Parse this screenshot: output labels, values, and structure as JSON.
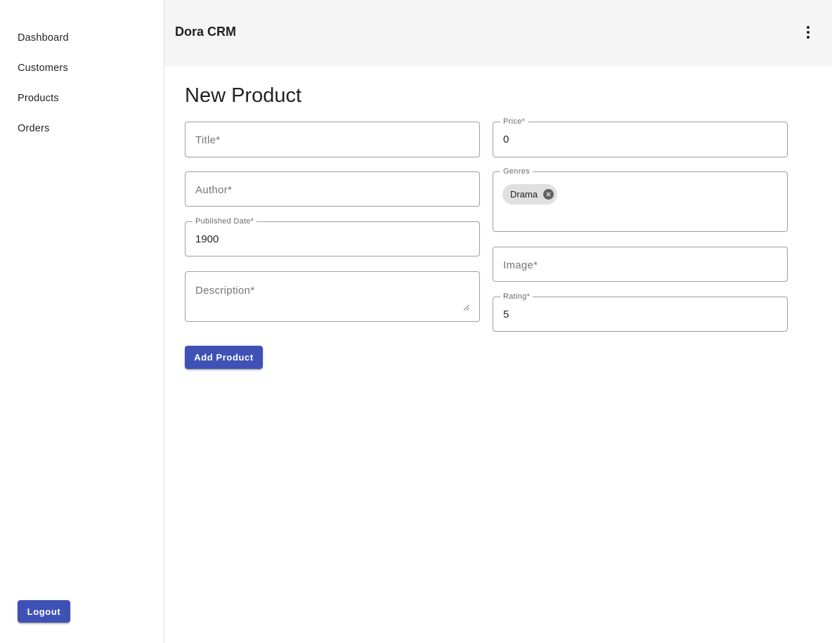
{
  "sidebar": {
    "items": [
      {
        "label": "Dashboard"
      },
      {
        "label": "Customers"
      },
      {
        "label": "Products"
      },
      {
        "label": "Orders"
      }
    ],
    "logout_label": "Logout"
  },
  "header": {
    "title": "Dora CRM",
    "menu_icon": "more-vert-icon"
  },
  "main": {
    "title": "New Product",
    "form": {
      "title_field": {
        "placeholder": "Title*",
        "value": ""
      },
      "author_field": {
        "placeholder": "Author*",
        "value": ""
      },
      "published_date": {
        "label": "Published Date*",
        "value": "1900"
      },
      "description": {
        "placeholder": "Description*",
        "value": ""
      },
      "price": {
        "label": "Price*",
        "value": "0"
      },
      "genres": {
        "label": "Genres",
        "chips": [
          "Drama"
        ]
      },
      "image": {
        "placeholder": "Image*",
        "value": ""
      },
      "rating": {
        "label": "Rating*",
        "value": "5"
      },
      "submit_label": "Add Product"
    }
  },
  "colors": {
    "primary": "#3f51b5",
    "appbar_bg": "#f5f5f5",
    "chip_bg": "#e0e0e0"
  }
}
